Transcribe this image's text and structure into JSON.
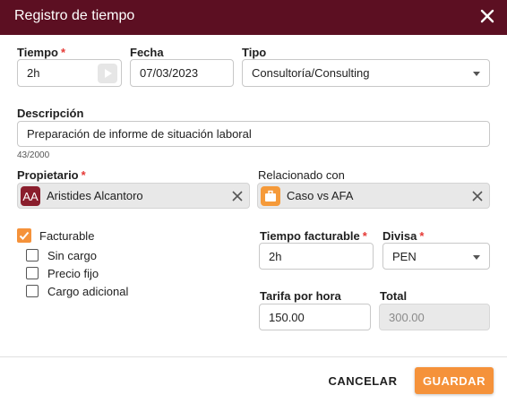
{
  "dialog": {
    "title": "Registro de tiempo",
    "close_icon": "close-icon"
  },
  "form": {
    "tiempo": {
      "label": "Tiempo",
      "required": "*",
      "value": "2h"
    },
    "fecha": {
      "label": "Fecha",
      "value": "07/03/2023"
    },
    "tipo": {
      "label": "Tipo",
      "value": "Consultoría/Consulting"
    },
    "descripcion": {
      "label": "Descripción",
      "value": "Preparación de informe de situación laboral",
      "counter": "43/2000"
    },
    "propietario": {
      "label": "Propietario",
      "required": "*",
      "initials": "AA",
      "value": "Aristides Alcantoro"
    },
    "relacionado": {
      "label": "Relacionado con",
      "value": "Caso vs AFA"
    },
    "facturable": {
      "label": "Facturable",
      "checked": true
    },
    "options": [
      {
        "label": "Sin cargo"
      },
      {
        "label": "Precio fijo"
      },
      {
        "label": "Cargo adicional"
      }
    ],
    "tiempo_facturable": {
      "label": "Tiempo facturable",
      "required": "*",
      "value": "2h"
    },
    "divisa": {
      "label": "Divisa",
      "required": "*",
      "value": "PEN"
    },
    "tarifa": {
      "label": "Tarifa por hora",
      "value": "150.00"
    },
    "total": {
      "label": "Total",
      "value": "300.00"
    }
  },
  "footer": {
    "cancel_label": "CANCELAR",
    "save_label": "GUARDAR"
  },
  "colors": {
    "header": "#5c0f22",
    "accent": "#f5923a",
    "avatar": "#8a1e2d"
  }
}
